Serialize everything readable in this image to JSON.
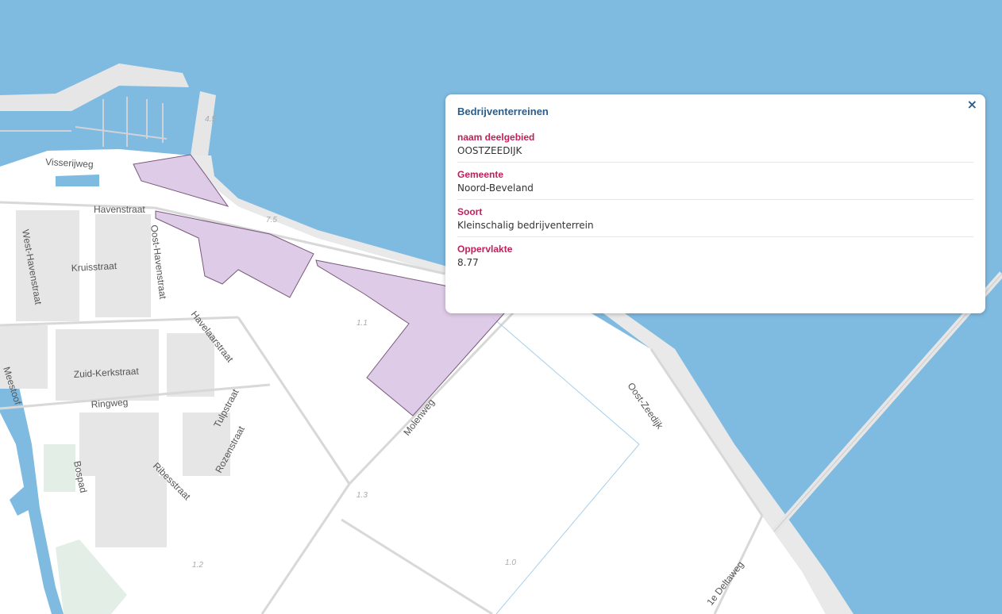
{
  "map": {
    "streets": [
      "Visserijweg",
      "Havenstraat",
      "West-Havenstraat",
      "Oost-Havenstraat",
      "Kruisstraat",
      "Havelaarstraat",
      "Zuid-Kerkstraat",
      "Ringweg",
      "Meestoof",
      "Tulpstraat",
      "Rozenstraat",
      "Ribesstraat",
      "Bospad",
      "Molenweg",
      "Oost-Zeedijk",
      "1e Deltaweg"
    ],
    "heights": [
      "4.5",
      "7.5",
      "1.1",
      "1.3",
      "1.2",
      "1.0"
    ],
    "colors": {
      "water": "#7fbbe1",
      "land": "#ffffff",
      "polygon_fill": "#d8c2e3",
      "polygon_stroke": "#7a5a7a"
    }
  },
  "popup": {
    "title": "Bedrijventerreinen",
    "close_icon": "×",
    "fields": [
      {
        "label": "naam deelgebied",
        "value": "OOSTZEEDIJK"
      },
      {
        "label": "Gemeente",
        "value": "Noord-Beveland"
      },
      {
        "label": "Soort",
        "value": "Kleinschalig bedrijventerrein"
      },
      {
        "label": "Oppervlakte",
        "value": "8.77"
      }
    ]
  }
}
